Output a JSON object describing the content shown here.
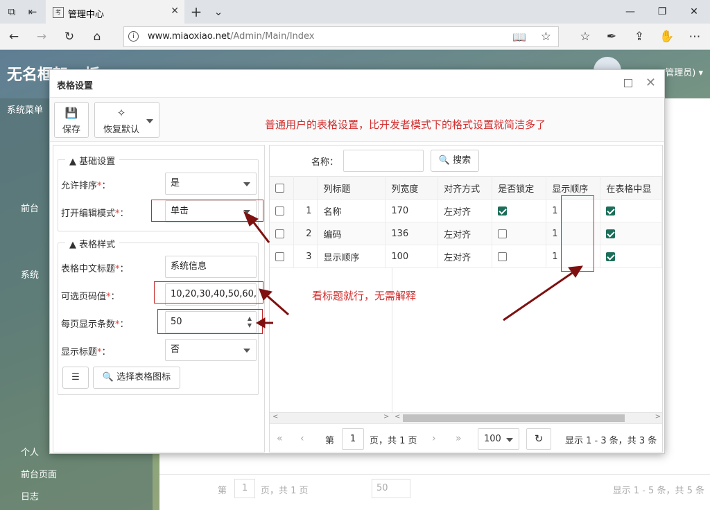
{
  "browser": {
    "tab_title": "管理中心",
    "tab_favicon": "考",
    "url_host": "www.miaoxiao.net",
    "url_path": "/Admin/Main/Index"
  },
  "background": {
    "app_title": "无名框架 · 板",
    "sidebar_header": "系统菜单",
    "user_label": "管理员) ▾",
    "sidebar_items": [
      "前台",
      "系统",
      "个人",
      "前台页面",
      "日志"
    ],
    "pager": {
      "page_prefix": "第",
      "page": "1",
      "page_suffix": "页，共 1 页",
      "per_page": "50",
      "summary": "显示 1 - 5 条，共 5 条"
    }
  },
  "dialog": {
    "title": "表格设置",
    "toolbar": {
      "save": "保存",
      "restore": "恢复默认"
    },
    "note_top": "普通用户的表格设置，比开发者模式下的格式设置就简洁多了",
    "note_mid": "看标题就行，无需解释",
    "basic_legend": "基础设置",
    "style_legend": "表格样式",
    "fields": {
      "allow_sort": {
        "label": "允许排序",
        "value": "是"
      },
      "edit_mode": {
        "label": "打开编辑模式",
        "value": "单击"
      },
      "cn_title": {
        "label": "表格中文标题",
        "value": "系统信息"
      },
      "page_sizes": {
        "label": "可选页码值",
        "value": "10,20,30,40,50,60,"
      },
      "per_page": {
        "label": "每页显示条数",
        "value": "50"
      },
      "show_title": {
        "label": "显示标题",
        "value": "否"
      }
    },
    "choose_icon_button": "选择表格图标",
    "search": {
      "label": "名称：",
      "button": "搜索"
    },
    "grid": {
      "columns": [
        "列标题",
        "列宽度",
        "对齐方式",
        "是否锁定",
        "显示顺序",
        "在表格中显"
      ],
      "rows": [
        {
          "no": "1",
          "title": "名称",
          "width": "170",
          "align": "左对齐",
          "locked": true,
          "order": "1",
          "show": true
        },
        {
          "no": "2",
          "title": "编码",
          "width": "136",
          "align": "左对齐",
          "locked": false,
          "order": "1",
          "show": true
        },
        {
          "no": "3",
          "title": "显示顺序",
          "width": "100",
          "align": "左对齐",
          "locked": false,
          "order": "1",
          "show": true
        }
      ]
    },
    "pager": {
      "page_prefix": "第",
      "page": "1",
      "page_suffix": "页，共 1 页",
      "per_page": "100",
      "summary": "显示 1 - 3 条，共 3 条"
    }
  },
  "colors": {
    "annotation": "#d32f2f",
    "arrow": "#7f1010",
    "checkbox": "#1a6e5a"
  }
}
